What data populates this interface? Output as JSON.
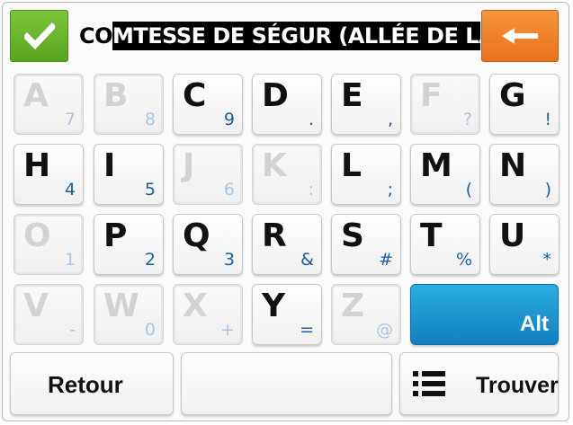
{
  "input": {
    "prefix": "CO",
    "selected": "MTESSE DE SÉGUR (ALLÉE DE LA)"
  },
  "icons": {
    "confirm": "check-icon",
    "backspace": "arrow-left-icon",
    "search": "list-icon"
  },
  "colors": {
    "confirm": "#6cb82d",
    "backspace": "#ef8228",
    "alt": "#1f96d1",
    "secondary_char": "#1c5fa8"
  },
  "keyboard": {
    "keys": [
      {
        "main": "A",
        "alt": "7",
        "enabled": false
      },
      {
        "main": "B",
        "alt": "8",
        "enabled": false
      },
      {
        "main": "C",
        "alt": "9",
        "enabled": true
      },
      {
        "main": "D",
        "alt": ".",
        "enabled": true
      },
      {
        "main": "E",
        "alt": ",",
        "enabled": true
      },
      {
        "main": "F",
        "alt": "?",
        "enabled": false
      },
      {
        "main": "G",
        "alt": "!",
        "enabled": true
      },
      {
        "main": "H",
        "alt": "4",
        "enabled": true
      },
      {
        "main": "I",
        "alt": "5",
        "enabled": true
      },
      {
        "main": "J",
        "alt": "6",
        "enabled": false
      },
      {
        "main": "K",
        "alt": ":",
        "enabled": false
      },
      {
        "main": "L",
        "alt": ";",
        "enabled": true
      },
      {
        "main": "M",
        "alt": "(",
        "enabled": true
      },
      {
        "main": "N",
        "alt": ")",
        "enabled": true
      },
      {
        "main": "O",
        "alt": "1",
        "enabled": false
      },
      {
        "main": "P",
        "alt": "2",
        "enabled": true
      },
      {
        "main": "Q",
        "alt": "3",
        "enabled": true
      },
      {
        "main": "R",
        "alt": "&",
        "enabled": true
      },
      {
        "main": "S",
        "alt": "#",
        "enabled": true
      },
      {
        "main": "T",
        "alt": "%",
        "enabled": true
      },
      {
        "main": "U",
        "alt": "*",
        "enabled": true
      },
      {
        "main": "V",
        "alt": "-",
        "enabled": false
      },
      {
        "main": "W",
        "alt": "0",
        "enabled": false
      },
      {
        "main": "X",
        "alt": "+",
        "enabled": false
      },
      {
        "main": "Y",
        "alt": "=",
        "enabled": true
      },
      {
        "main": "Z",
        "alt": "@",
        "enabled": false
      }
    ],
    "alt_label": "Alt"
  },
  "buttons": {
    "back": "Retour",
    "search": "Trouver"
  }
}
